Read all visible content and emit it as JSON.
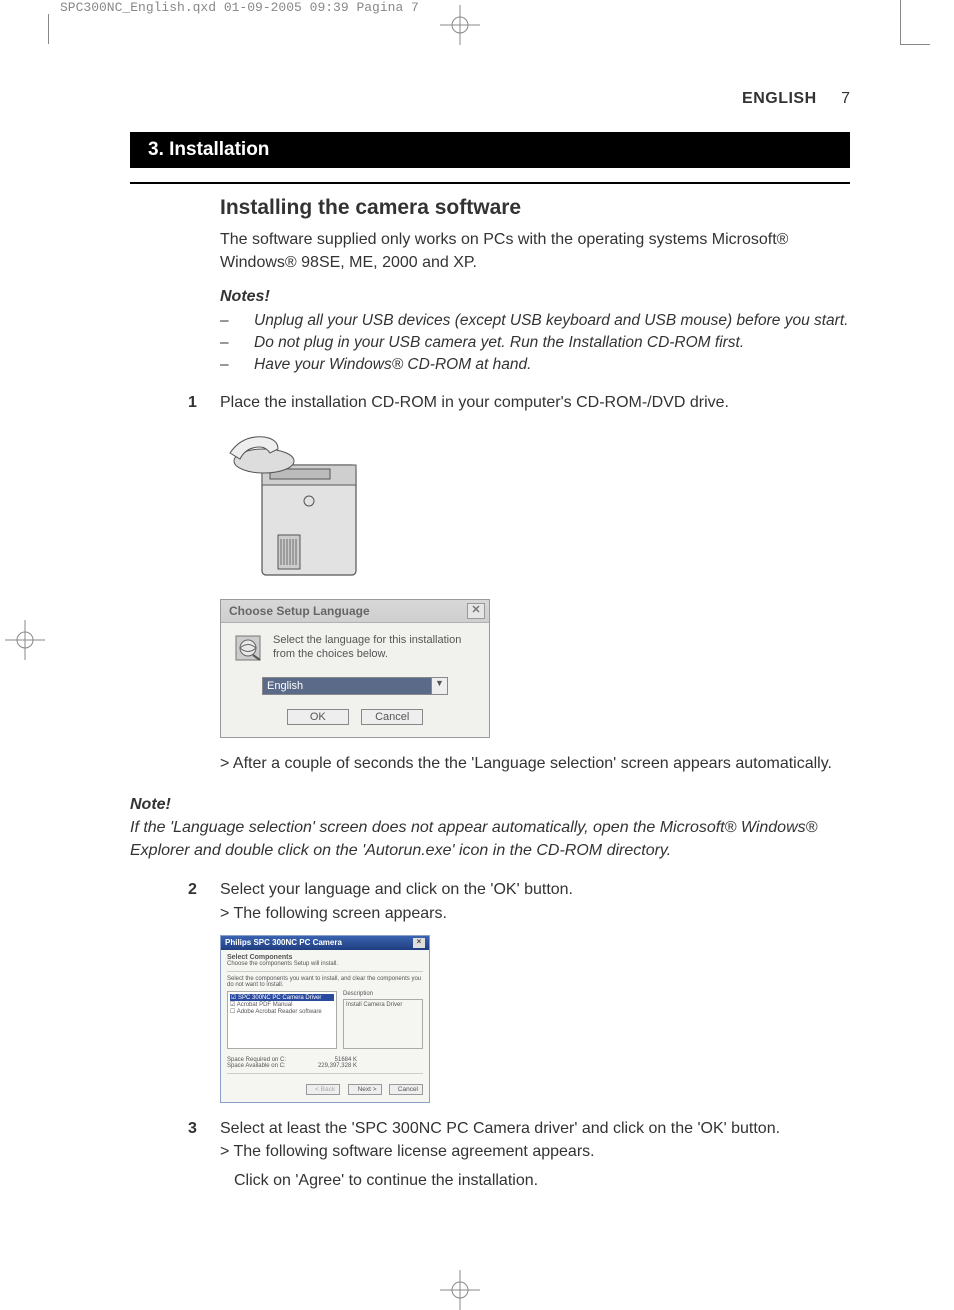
{
  "print_header": "SPC300NC_English.qxd  01-09-2005  09:39  Pagina 7",
  "header": {
    "language": "ENGLISH",
    "page_number": "7"
  },
  "section_title": "3. Installation",
  "subheading": "Installing the camera software",
  "intro_para": "The software supplied only works on PCs with the operating systems Microsoft® Windows® 98SE, ME, 2000 and XP.",
  "notes_heading": "Notes!",
  "notes": [
    "Unplug all your USB devices (except USB keyboard and USB mouse) before you start.",
    "Do not plug in your USB camera yet. Run the Installation CD-ROM first.",
    "Have your Windows® CD-ROM at hand."
  ],
  "step1": {
    "num": "1",
    "text": "Place the installation CD-ROM in your computer's CD-ROM-/DVD drive.",
    "result": "> After a couple of seconds the the 'Language selection' screen appears automatically."
  },
  "dialog_language": {
    "title": "Choose Setup Language",
    "message": "Select the language for this installation from the choices below.",
    "selected": "English",
    "ok": "OK",
    "cancel": "Cancel"
  },
  "note2_heading": "Note!",
  "note2_body": "If the 'Language selection' screen does not appear automatically, open the Microsoft® Windows® Explorer and double click on the 'Autorun.exe' icon in the CD-ROM directory.",
  "step2": {
    "num": "2",
    "text": "Select your language and click on the 'OK' button.",
    "result": "> The following screen appears."
  },
  "dialog_components": {
    "title": "Philips SPC 300NC PC Camera",
    "heading": "Select Components",
    "sub": "Choose the components Setup will install.",
    "instr": "Select the components you want to install, and clear the components you do not want to install.",
    "items": [
      "SPC 300NC PC Camera Driver",
      "Acrobat PDF Manual",
      "Adobe Acrobat Reader software"
    ],
    "desc_label": "Description",
    "desc_text": "Install Camera Driver",
    "space_req_label": "Space Required on  C:",
    "space_req_val": "51684 K",
    "space_avail_label": "Space Available on  C:",
    "space_avail_val": "229,397,328 K",
    "back": "< Back",
    "next": "Next >",
    "cancel": "Cancel"
  },
  "step3": {
    "num": "3",
    "text": "Select at least the 'SPC 300NC PC Camera driver' and click on the 'OK' button.",
    "result": "> The following software license agreement appears.",
    "result2": "Click on 'Agree' to continue the installation."
  }
}
